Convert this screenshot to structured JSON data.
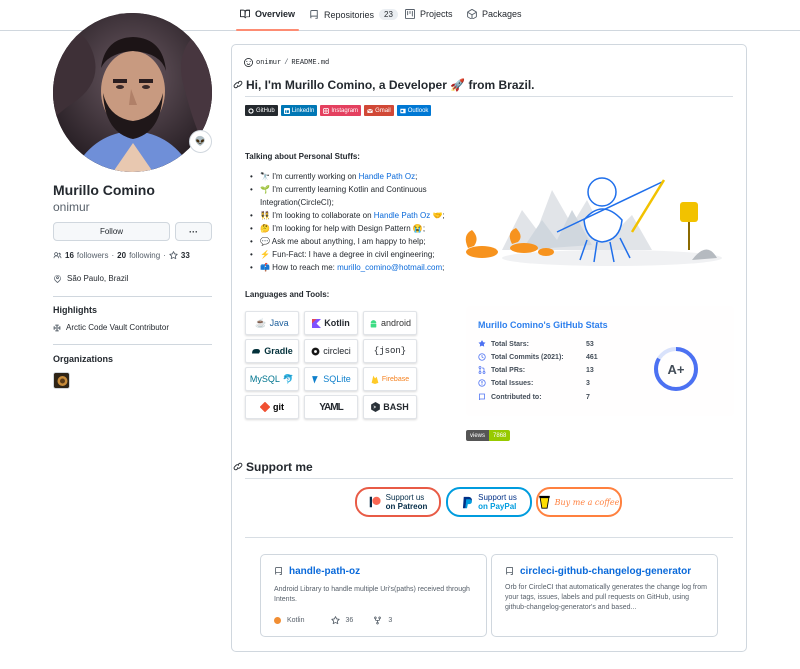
{
  "tabs": [
    {
      "label": "Overview",
      "icon": "book-icon",
      "selected": true
    },
    {
      "label": "Repositories",
      "icon": "repo-icon",
      "count": "23"
    },
    {
      "label": "Projects",
      "icon": "project-icon"
    },
    {
      "label": "Packages",
      "icon": "package-icon"
    }
  ],
  "profile": {
    "name": "Murillo Comino",
    "login": "onimur",
    "follow_label": "Follow",
    "more_label": "···",
    "followers_count": "16",
    "followers_label": "followers",
    "following_count": "20",
    "following_label": "following",
    "stars_count": "33",
    "location": "São Paulo, Brazil",
    "highlights_heading": "Highlights",
    "achievement": "Arctic Code Vault Contributor",
    "organizations_heading": "Organizations"
  },
  "readme": {
    "path_user": "onimur",
    "path_sep": "/",
    "path_file": "README.md",
    "title": "Hi, I'm Murillo Comino, a Developer 🚀 from Brazil.",
    "badges": [
      {
        "label": "GitHub",
        "color": "#24292e",
        "icon": "github-icon"
      },
      {
        "label": "LinkedIn",
        "color": "#0077b5",
        "icon": "linkedin-icon"
      },
      {
        "label": "Instagram",
        "color": "#e4405f",
        "icon": "instagram-icon"
      },
      {
        "label": "Gmail",
        "color": "#d14836",
        "icon": "gmail-icon"
      },
      {
        "label": "Outlook",
        "color": "#0078d4",
        "icon": "outlook-icon"
      }
    ],
    "personal_heading": "Talking about Personal Stuffs:",
    "items": [
      {
        "pre": "🔭 I'm currently working on ",
        "link": "Handle Path Oz",
        "post": ";"
      },
      {
        "pre": "🌱 I'm currently learning Kotlin and Continuous Integration(CircleCI);",
        "link": "",
        "post": ""
      },
      {
        "pre": "👯 I'm looking to collaborate on ",
        "link": "Handle Path Oz",
        "post": " 🤝;"
      },
      {
        "pre": "🤔 I'm looking for help with Design Pattern 😭;",
        "link": "",
        "post": ""
      },
      {
        "pre": "💬 Ask me about anything, I am happy to help;",
        "link": "",
        "post": ""
      },
      {
        "pre": "⚡ Fun-Fact: I have a degree in civil engineering;",
        "link": "",
        "post": ""
      },
      {
        "pre": "📫 How to reach me: ",
        "link": "murillo_comino@hotmail.com",
        "post": ";"
      }
    ],
    "tools_heading": "Languages and Tools:",
    "tools": [
      {
        "label": "Java",
        "icon": "java-icon",
        "color": "#1b5e9b"
      },
      {
        "label": "Kotlin",
        "icon": "kotlin-icon",
        "color": "#000000"
      },
      {
        "label": "android",
        "icon": "android-icon",
        "color": "#3ddc84"
      },
      {
        "label": "Gradle",
        "icon": "gradle-icon",
        "color": "#02303a"
      },
      {
        "label": "circleci",
        "icon": "circleci-icon",
        "color": "#161616"
      },
      {
        "label": "{json}",
        "icon": "json-icon",
        "color": "#000000"
      },
      {
        "label": "MySQL",
        "icon": "mysql-icon",
        "color": "#00758f"
      },
      {
        "label": "SQLite",
        "icon": "sqlite-icon",
        "color": "#0f80cc"
      },
      {
        "label": "Firebase",
        "icon": "firebase-icon",
        "color": "#f58220"
      },
      {
        "label": "git",
        "icon": "git-icon",
        "color": "#f05032"
      },
      {
        "label": "YAML",
        "icon": "yaml-icon",
        "color": "#000000"
      },
      {
        "label": "BASH",
        "icon": "bash-icon",
        "color": "#000000"
      }
    ],
    "stats": {
      "title": "Murillo Comino's GitHub Stats",
      "rows": [
        {
          "label": "Total Stars:",
          "value": "53",
          "icon": "star-icon"
        },
        {
          "label": "Total Commits (2021):",
          "value": "461",
          "icon": "history-icon"
        },
        {
          "label": "Total PRs:",
          "value": "13",
          "icon": "pull-request-icon"
        },
        {
          "label": "Total Issues:",
          "value": "3",
          "icon": "issue-icon"
        },
        {
          "label": "Contributed to:",
          "value": "7",
          "icon": "repo-icon"
        }
      ],
      "grade": "A+",
      "title_color": "#2f80ed",
      "ring_color": "#4c71f2"
    },
    "views_label": "views",
    "views_count": "7868",
    "support_heading": "Support me",
    "support": [
      {
        "line1": "Support us",
        "line2": "on Patreon",
        "icon": "patreon-icon",
        "color": "#e85b46"
      },
      {
        "line1": "Support us",
        "line2": "on PayPal",
        "icon": "paypal-icon",
        "color": "#009cde"
      },
      {
        "line1": "Buy me a coffee",
        "line2": "",
        "icon": "coffee-icon",
        "color": "#ff813f"
      }
    ]
  },
  "pinned": [
    {
      "name": "handle-path-oz",
      "desc": "Android Library to handle multiple Uri's(paths) received through Intents.",
      "lang": "Kotlin",
      "lang_color": "#F18E33",
      "stars": "36",
      "forks": "3"
    },
    {
      "name": "circleci-github-changelog-generator",
      "desc": "Orb for CircleCI that automatically generates the change log from your tags, issues, labels and pull requests on GitHub, using github-changelog-generator's and based..."
    }
  ]
}
